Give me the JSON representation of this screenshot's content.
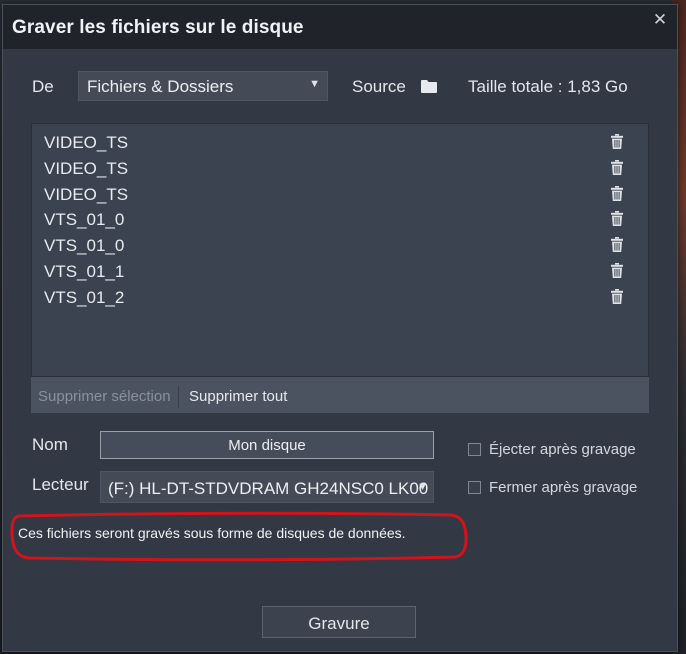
{
  "dialog": {
    "title": "Graver les fichiers sur le disque",
    "close_glyph": "✕"
  },
  "source_row": {
    "from_label": "De",
    "source_select": {
      "selected": "Fichiers & Dossiers",
      "arrow_glyph": "▼"
    },
    "source_label": "Source",
    "folder_icon": "folder-icon",
    "total_size": "Taille totale : 1,83 Go"
  },
  "files": [
    {
      "name": "VIDEO_TS"
    },
    {
      "name": "VIDEO_TS"
    },
    {
      "name": "VIDEO_TS"
    },
    {
      "name": "VTS_01_0"
    },
    {
      "name": "VTS_01_0"
    },
    {
      "name": "VTS_01_1"
    },
    {
      "name": "VTS_01_2"
    }
  ],
  "list_actions": {
    "delete_selection": "Supprimer sélection",
    "delete_all": "Supprimer tout"
  },
  "name_field": {
    "label": "Nom",
    "value": "Mon disque"
  },
  "drive_field": {
    "label": "Lecteur",
    "selected": "(F:) HL-DT-STDVDRAM GH24NSC0 LK00",
    "arrow_glyph": "▼"
  },
  "options": {
    "eject_after": {
      "label": "Éjecter après gravage",
      "checked": false
    },
    "close_after": {
      "label": "Fermer après gravage",
      "checked": false
    }
  },
  "info_text": "Ces fichiers seront gravés sous forme de disques de données.",
  "burn_button": "Gravure",
  "colors": {
    "dialog_bg": "#323844",
    "title_bar": "#202329",
    "list_bg": "#3b4250",
    "highlight_ring": "#d0141c"
  }
}
